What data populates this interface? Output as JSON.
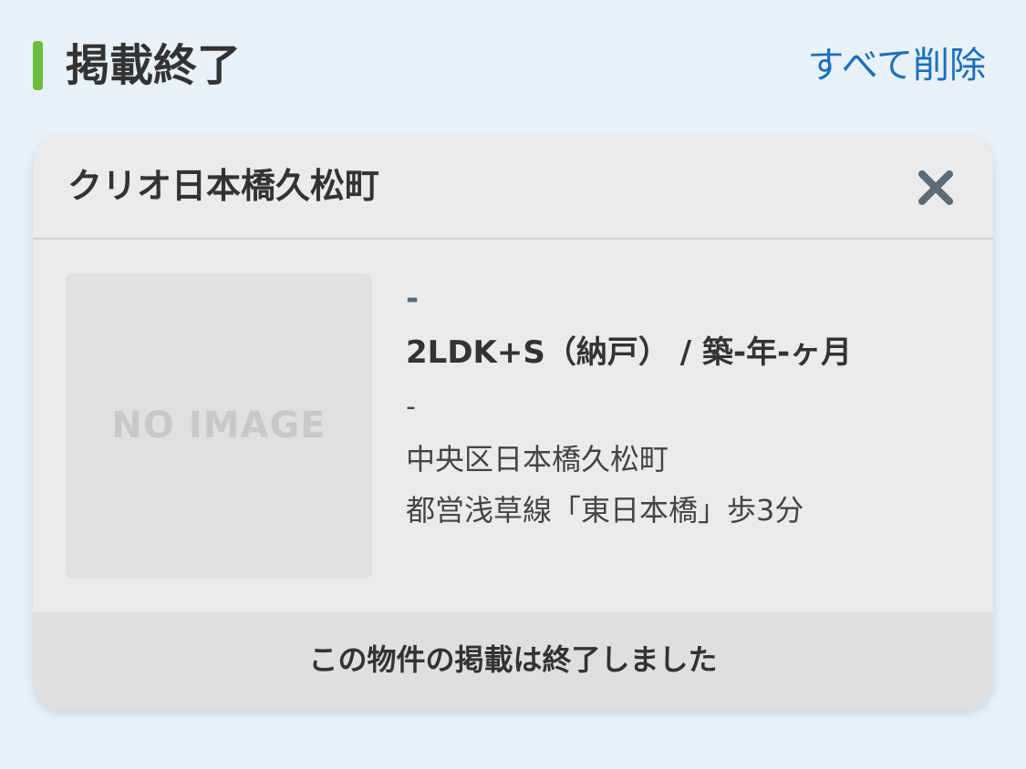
{
  "section": {
    "title": "掲載終了",
    "delete_all_label": "すべて削除"
  },
  "listing": {
    "name": "クリオ日本橋久松町",
    "image_placeholder": "NO IMAGE",
    "price": "-",
    "layout_age": "2LDK+S（納戸） / 築-年-ヶ月",
    "area": "-",
    "address": "中央区日本橋久松町",
    "station": "都営浅草線「東日本橋」歩3分",
    "ended_message": "この物件の掲載は終了しました"
  },
  "icons": {
    "close": "close-icon"
  },
  "colors": {
    "accent": "#6cbd3b",
    "link": "#1a6fc0",
    "background": "#e8f1f8",
    "card": "#ebebeb"
  }
}
